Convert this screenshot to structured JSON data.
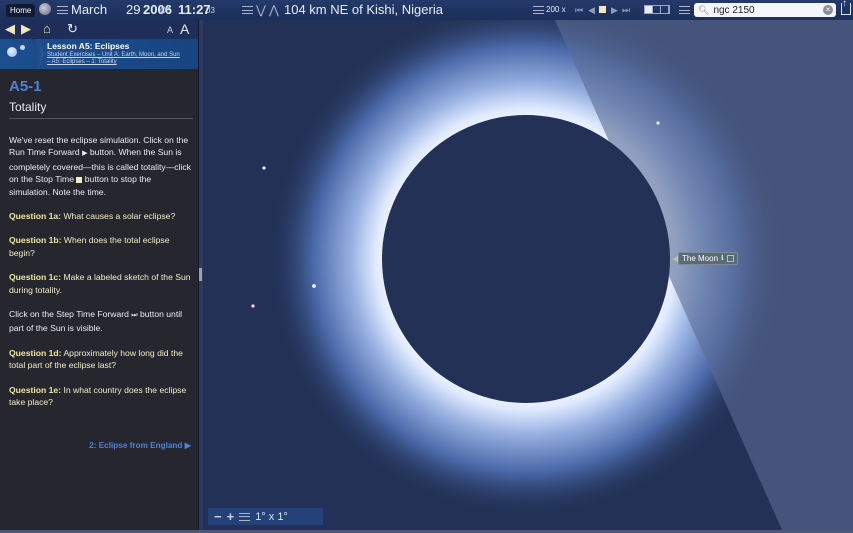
{
  "topbar": {
    "home_label": "Home",
    "date": "March",
    "day": "29",
    "year": "2006",
    "era": "CE",
    "time": "11:27",
    "seconds": "03",
    "location": "104 km NE of Kishi, Nigeria",
    "time_rate": "200",
    "time_rate_unit": "x",
    "search_value": "ngc 2150",
    "icons": [
      "globe-icon",
      "menu-icon",
      "chevron-down-icon",
      "chevron-up-icon",
      "step-back-icon",
      "play-back-icon",
      "stop-icon",
      "play-forward-icon",
      "step-forward-icon",
      "layout-icon",
      "search-icon",
      "clear-icon",
      "share-icon"
    ]
  },
  "colors": {
    "accent": "#4e83d4",
    "question": "#efe6a0",
    "sky": "#223155",
    "panel": "#26262f"
  },
  "panel": {
    "nav": {
      "font_small": "A",
      "font_large": "A"
    },
    "lesson": {
      "title": "Lesson A5: Eclipses",
      "crumb1": "Student Exercises – Unit A: Earth, Moon, and Sun",
      "crumb2": "– A5: Eclipses – 1: Totality"
    },
    "section_code": "A5-1",
    "section_title": "Totality",
    "intro_a": "We've reset the eclipse simulation. Click on the Run Time Forward",
    "intro_b": "button. When the Sun is completely covered—this is called totality—click on the Stop Time",
    "intro_c": "button to stop the simulation. Note the time.",
    "questions": [
      {
        "label": "Question 1a:",
        "text": " What causes a solar eclipse?"
      },
      {
        "label": "Question 1b:",
        "text": " When does the total eclipse begin?"
      },
      {
        "label": "Question 1c:",
        "text": " Make a labeled sketch of the Sun during totality."
      }
    ],
    "step_a": "Click on the Step Time Forward",
    "step_b": "button until part of the Sun is visible.",
    "questions2": [
      {
        "label": "Question 1d:",
        "text": " Approximately how long did the total part of the eclipse last?"
      },
      {
        "label": "Question 1e:",
        "text": " In what country does the eclipse take place?"
      }
    ],
    "next_link": "2: Eclipse from England ▶"
  },
  "sky": {
    "moon_label": "The Moon",
    "fov": "1° x 1°"
  }
}
